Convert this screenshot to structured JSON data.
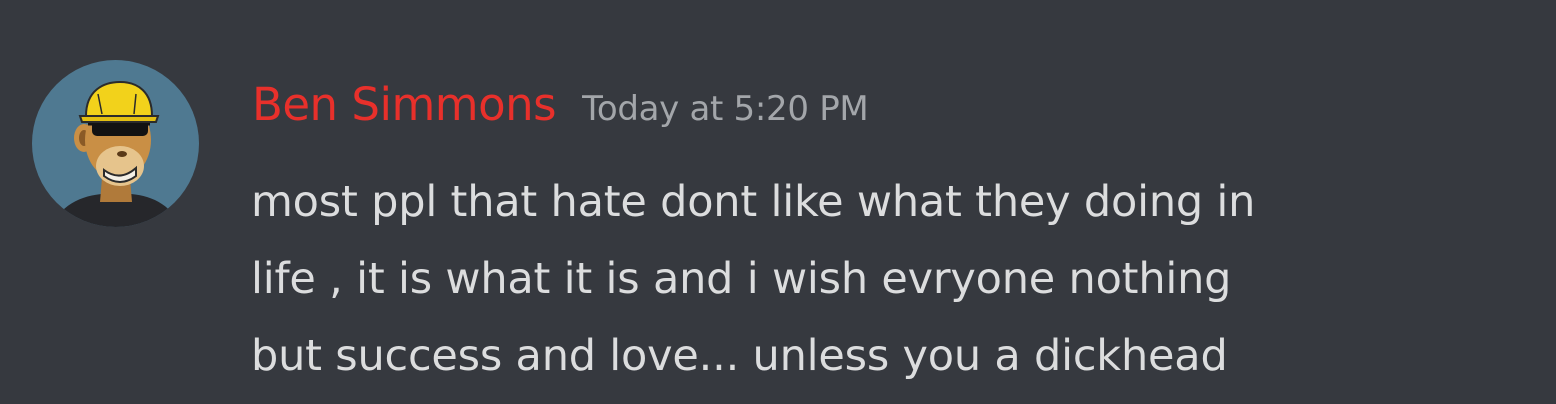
{
  "message": {
    "author": {
      "name": "Ben Simmons",
      "name_color": "#e8302b",
      "avatar_icon": "bored-ape-avatar-icon"
    },
    "timestamp": "Today at 5:20 PM",
    "content_lines": [
      "most ppl that hate dont like what they doing in",
      "life , it is what it is and i wish evryone nothing",
      "but success and love... unless you a dickhead"
    ]
  },
  "theme": {
    "background": "#36393f",
    "text": "#dcddde",
    "muted": "#a3a6aa",
    "avatar_bg": "#4f7991"
  }
}
